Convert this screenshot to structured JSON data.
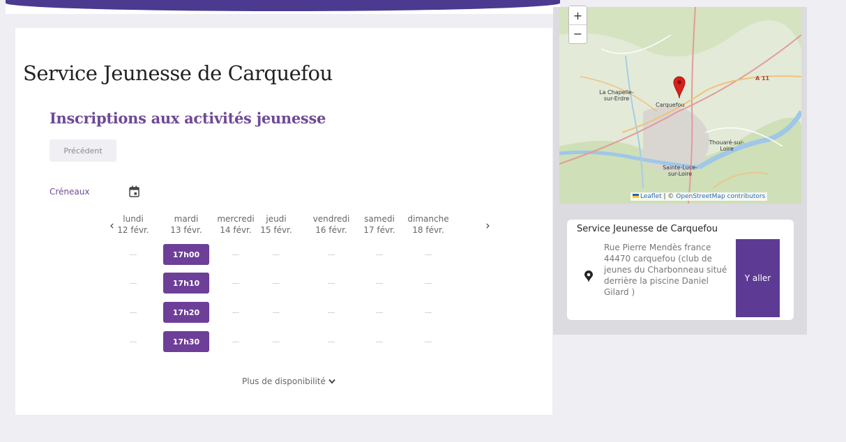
{
  "header": {
    "title": "Service Jeunesse de Carquefou"
  },
  "section": {
    "title": "Inscriptions aux activités jeunesse",
    "prev_label": "Précédent",
    "slots_label": "Créneaux",
    "more_label": "Plus de disponibilité"
  },
  "calendar": {
    "days": [
      {
        "name": "lundi",
        "date": "12 févr."
      },
      {
        "name": "mardi",
        "date": "13 févr."
      },
      {
        "name": "mercredi",
        "date": "14 févr."
      },
      {
        "name": "jeudi",
        "date": "15 févr."
      },
      {
        "name": "vendredi",
        "date": "16 févr."
      },
      {
        "name": "samedi",
        "date": "17 févr."
      },
      {
        "name": "dimanche",
        "date": "18 févr."
      }
    ],
    "slots": [
      "17h00",
      "17h10",
      "17h20",
      "17h30"
    ],
    "prev_arrow": "‹",
    "next_arrow": "›"
  },
  "map": {
    "zoom_in": "+",
    "zoom_out": "−",
    "attribution_leaflet": "Leaflet",
    "attribution_sep": " | © ",
    "attribution_osm": "OpenStreetMap contributors",
    "labels": {
      "chapelle": "La Chapelle-sur-Erdre",
      "carquefou": "Carquefou",
      "thouare": "Thouaré-sur-Loire",
      "sainte_luce": "Sainte-Luce-sur-Loire",
      "a11": "A 11"
    }
  },
  "location": {
    "title": "Service Jeunesse de Carquefou",
    "address": "Rue Pierre Mendès france 44470 carquefou (club de jeunes du Charbonneau situé derrière la piscine Daniel Gilard )",
    "go_label": "Y aller"
  },
  "colors": {
    "accent": "#6d3f98",
    "banner": "#4b3a8f",
    "button": "#5d3b94"
  }
}
